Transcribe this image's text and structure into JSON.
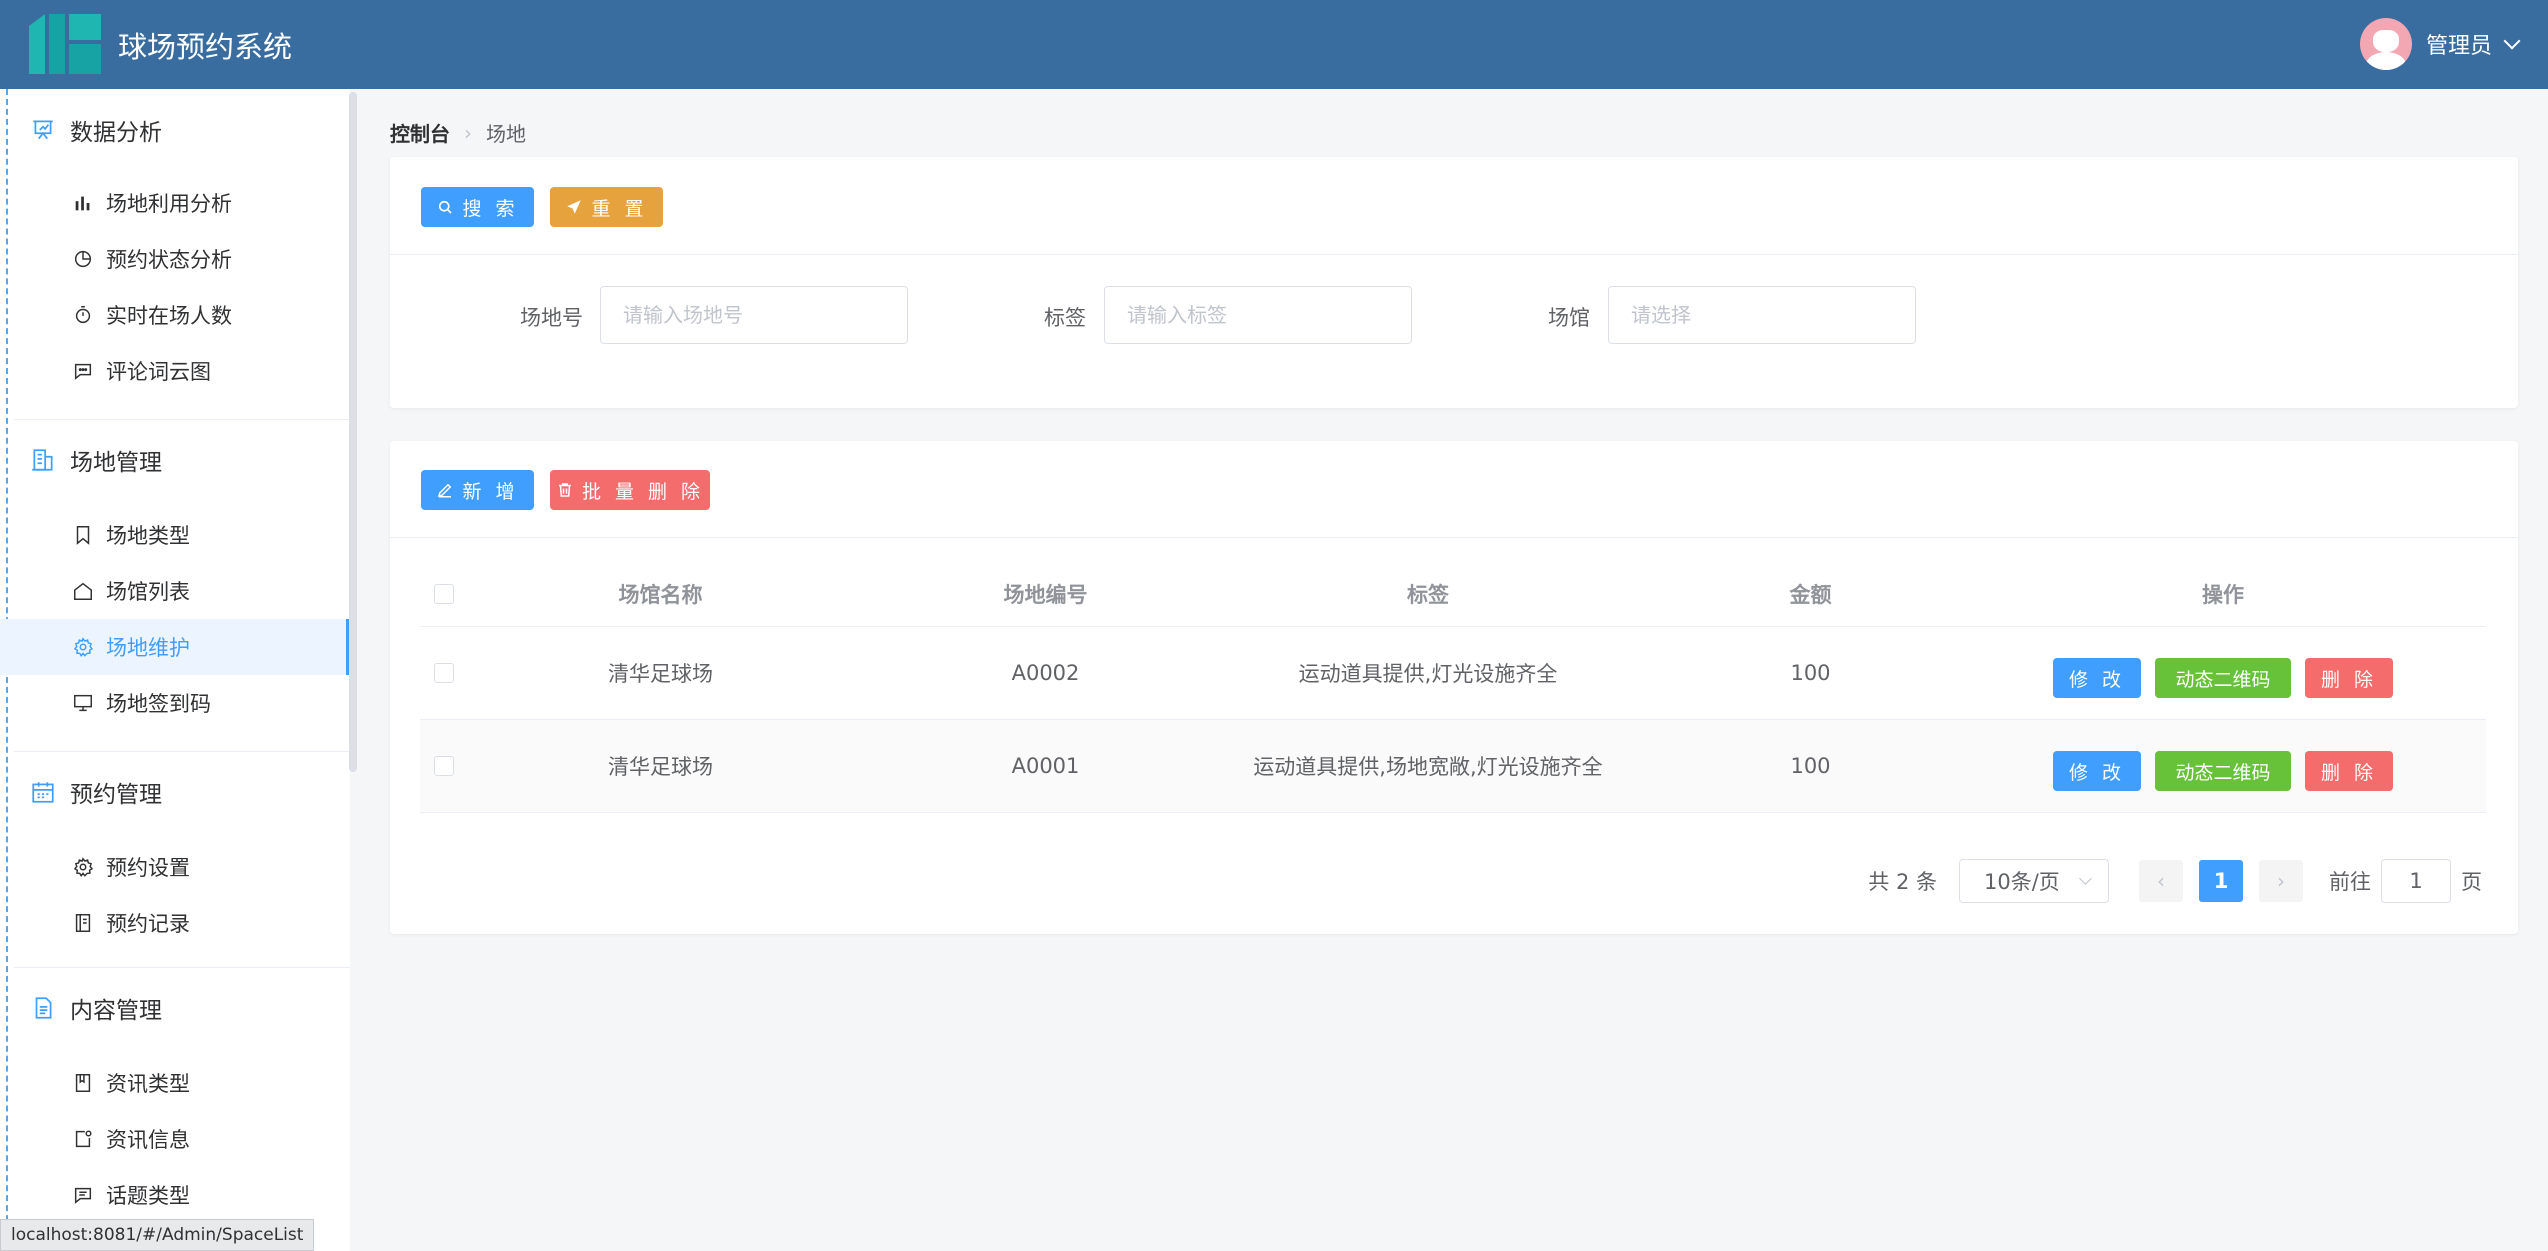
{
  "header": {
    "app_title": "球场预约系统",
    "user_name": "管理员"
  },
  "sidebar": {
    "groups": [
      {
        "title": "数据分析",
        "icon": "chart-presentation-icon",
        "items": [
          {
            "label": "场地利用分析",
            "icon": "bar-chart-icon"
          },
          {
            "label": "预约状态分析",
            "icon": "pie-chart-icon"
          },
          {
            "label": "实时在场人数",
            "icon": "stopwatch-icon"
          },
          {
            "label": "评论词云图",
            "icon": "chat-dots-icon"
          }
        ]
      },
      {
        "title": "场地管理",
        "icon": "office-building-icon",
        "items": [
          {
            "label": "场地类型",
            "icon": "bookmark-icon"
          },
          {
            "label": "场馆列表",
            "icon": "house-icon"
          },
          {
            "label": "场地维护",
            "icon": "gear-icon",
            "active": true
          },
          {
            "label": "场地签到码",
            "icon": "monitor-icon"
          }
        ]
      },
      {
        "title": "预约管理",
        "icon": "calendar-icon",
        "items": [
          {
            "label": "预约设置",
            "icon": "gear-icon"
          },
          {
            "label": "预约记录",
            "icon": "notebook-icon"
          }
        ]
      },
      {
        "title": "内容管理",
        "icon": "document-icon",
        "items": [
          {
            "label": "资讯类型",
            "icon": "book-icon"
          },
          {
            "label": "资讯信息",
            "icon": "news-icon"
          },
          {
            "label": "话题类型",
            "icon": "chat-square-icon"
          }
        ]
      }
    ]
  },
  "breadcrumb": {
    "root": "控制台",
    "current": "场地"
  },
  "search_panel": {
    "search_label": "搜 索",
    "reset_label": "重 置",
    "fields": [
      {
        "label": "场地号",
        "placeholder": "请输入场地号"
      },
      {
        "label": "标签",
        "placeholder": "请输入标签"
      },
      {
        "label": "场馆",
        "placeholder": "请选择"
      }
    ]
  },
  "table_panel": {
    "add_label": "新 增",
    "batch_delete_label": "批 量 删 除",
    "columns": [
      "场馆名称",
      "场地编号",
      "标签",
      "金额",
      "操作"
    ],
    "rows": [
      {
        "venue": "清华足球场",
        "code": "A0002",
        "tags": "运动道具提供,灯光设施齐全",
        "amount": "100"
      },
      {
        "venue": "清华足球场",
        "code": "A0001",
        "tags": "运动道具提供,场地宽敞,灯光设施齐全",
        "amount": "100"
      }
    ],
    "actions": {
      "edit": "修 改",
      "qrcode": "动态二维码",
      "delete": "删 除"
    }
  },
  "pagination": {
    "total_text": "共 2 条",
    "page_size": "10条/页",
    "current_page": "1",
    "goto_prefix": "前往",
    "goto_value": "1",
    "goto_suffix": "页"
  },
  "status_bar": {
    "url": "localhost:8081/#/Admin/SpaceList"
  },
  "colors": {
    "header_bg": "#3a6d9f",
    "primary": "#409eff",
    "warning": "#e6a23c",
    "danger": "#f56c6c",
    "success": "#67c23a"
  }
}
